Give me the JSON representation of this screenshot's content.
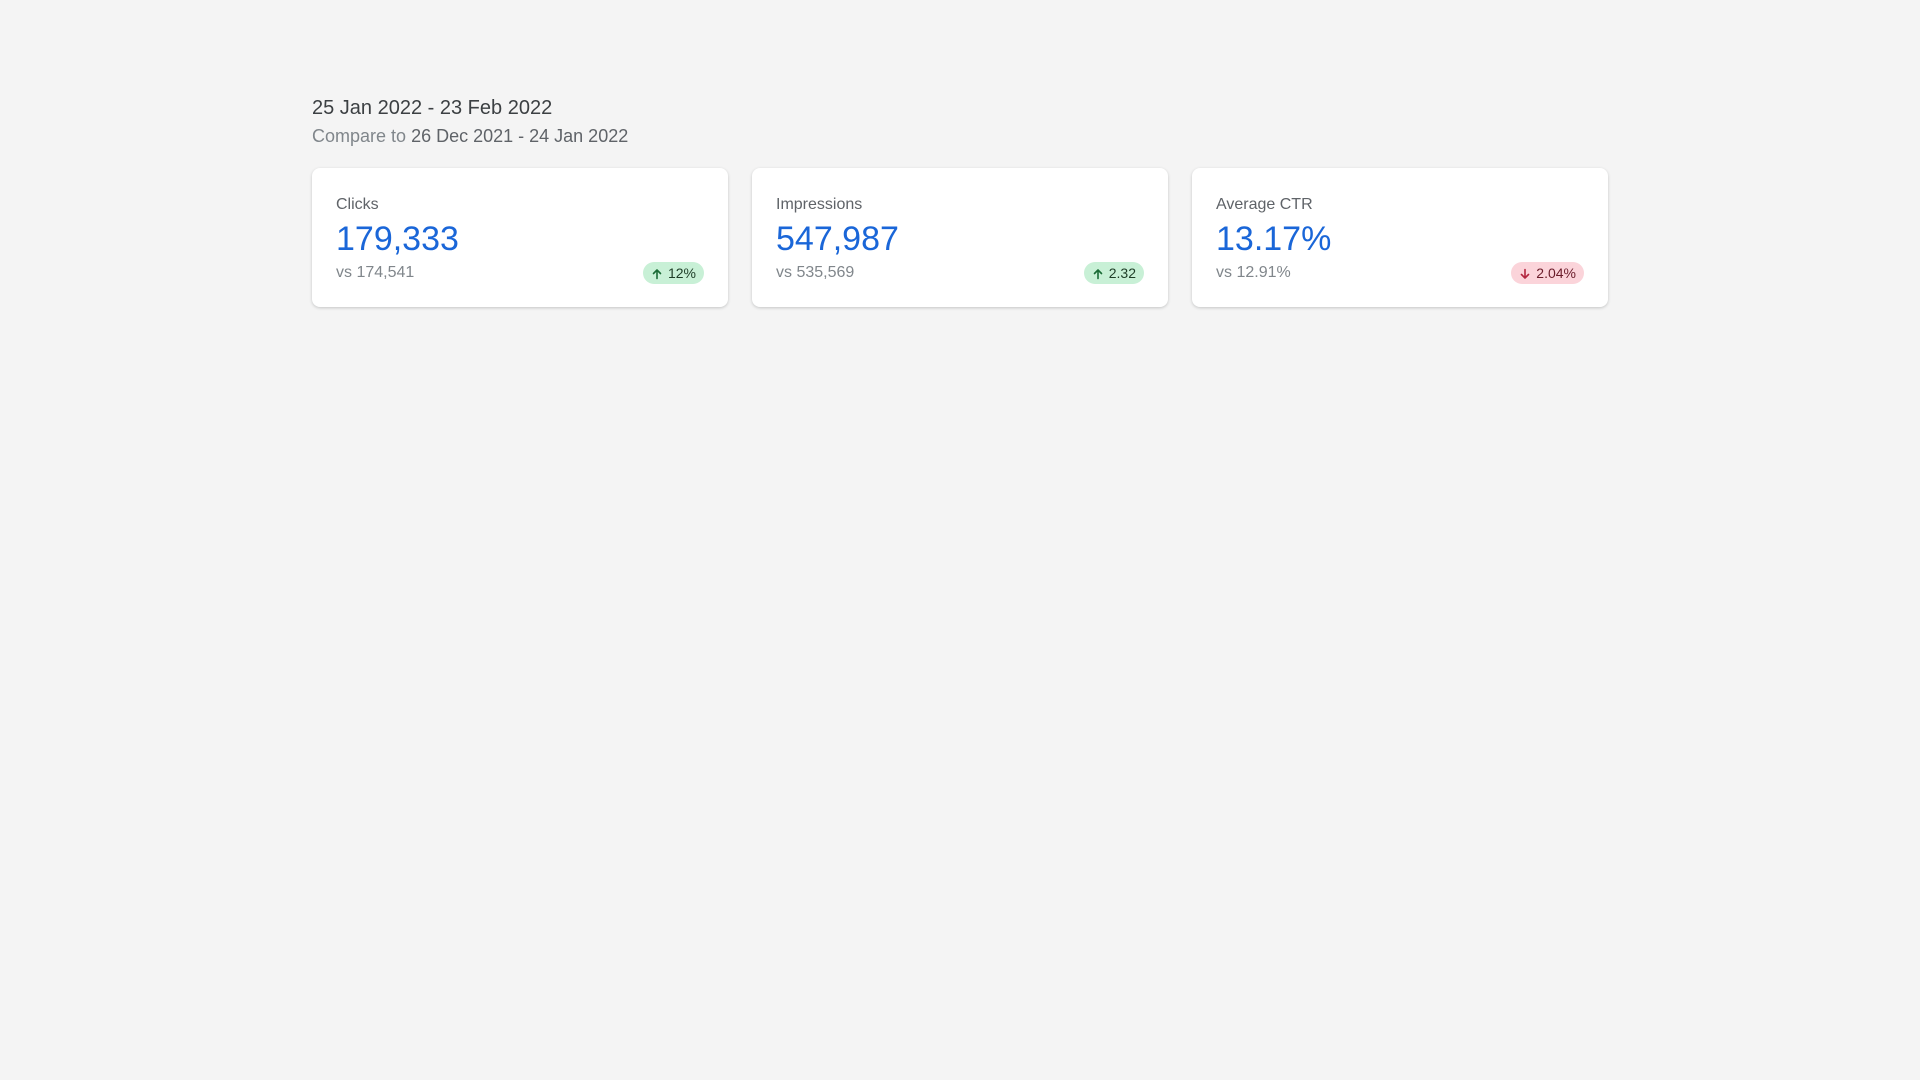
{
  "header": {
    "date_range": "25 Jan 2022 - 23 Feb 2022",
    "compare_prefix": "Compare to",
    "compare_range": "26 Dec 2021 - 24 Jan 2022"
  },
  "colors": {
    "accent_value": "#1a66d8",
    "badge_up_bg": "#c8f0d6",
    "badge_down_bg": "#fbd4da"
  },
  "cards": [
    {
      "label": "Clicks",
      "value": "179,333",
      "compare": "vs 174,541",
      "change": "12%",
      "direction": "up",
      "icon": "arrow-up-icon"
    },
    {
      "label": "Impressions",
      "value": "547,987",
      "compare": "vs 535,569",
      "change": "2.32",
      "direction": "up",
      "icon": "arrow-up-icon"
    },
    {
      "label": "Average CTR",
      "value": "13.17%",
      "compare": "vs 12.91%",
      "change": "2.04%",
      "direction": "down",
      "icon": "arrow-down-icon"
    }
  ]
}
